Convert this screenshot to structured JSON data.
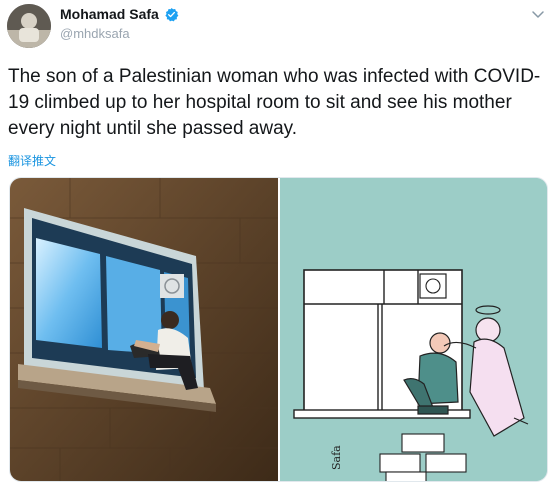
{
  "tweet": {
    "author_name": "Mohamad Safa",
    "author_handle": "@mhdksafa",
    "text": "The son of a Palestinian woman who was infected with COVID-19 climbed up to her hospital room to sit and see his mother every night until she passed away.",
    "translate_label": "翻译推文"
  },
  "icons": {
    "verified": "verified-badge-icon",
    "menu": "chevron-down-icon"
  },
  "colors": {
    "link": "#1b95e0",
    "verified": "#1da1f2",
    "cartoon_bg": "#9ccdc7"
  },
  "cartoon": {
    "signature": "Safa"
  }
}
